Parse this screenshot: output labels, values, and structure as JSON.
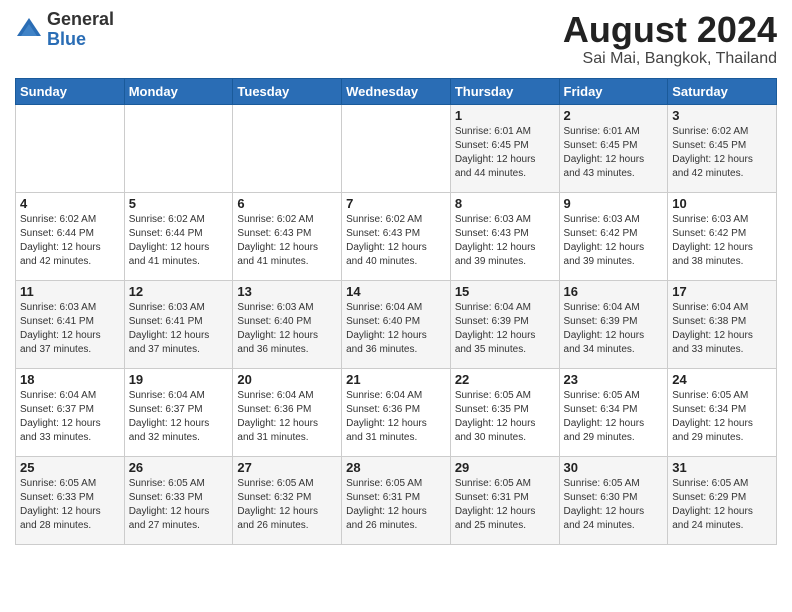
{
  "header": {
    "logo_general": "General",
    "logo_blue": "Blue",
    "month_year": "August 2024",
    "location": "Sai Mai, Bangkok, Thailand"
  },
  "days_of_week": [
    "Sunday",
    "Monday",
    "Tuesday",
    "Wednesday",
    "Thursday",
    "Friday",
    "Saturday"
  ],
  "weeks": [
    [
      {
        "day": "",
        "info": ""
      },
      {
        "day": "",
        "info": ""
      },
      {
        "day": "",
        "info": ""
      },
      {
        "day": "",
        "info": ""
      },
      {
        "day": "1",
        "info": "Sunrise: 6:01 AM\nSunset: 6:45 PM\nDaylight: 12 hours\nand 44 minutes."
      },
      {
        "day": "2",
        "info": "Sunrise: 6:01 AM\nSunset: 6:45 PM\nDaylight: 12 hours\nand 43 minutes."
      },
      {
        "day": "3",
        "info": "Sunrise: 6:02 AM\nSunset: 6:45 PM\nDaylight: 12 hours\nand 42 minutes."
      }
    ],
    [
      {
        "day": "4",
        "info": "Sunrise: 6:02 AM\nSunset: 6:44 PM\nDaylight: 12 hours\nand 42 minutes."
      },
      {
        "day": "5",
        "info": "Sunrise: 6:02 AM\nSunset: 6:44 PM\nDaylight: 12 hours\nand 41 minutes."
      },
      {
        "day": "6",
        "info": "Sunrise: 6:02 AM\nSunset: 6:43 PM\nDaylight: 12 hours\nand 41 minutes."
      },
      {
        "day": "7",
        "info": "Sunrise: 6:02 AM\nSunset: 6:43 PM\nDaylight: 12 hours\nand 40 minutes."
      },
      {
        "day": "8",
        "info": "Sunrise: 6:03 AM\nSunset: 6:43 PM\nDaylight: 12 hours\nand 39 minutes."
      },
      {
        "day": "9",
        "info": "Sunrise: 6:03 AM\nSunset: 6:42 PM\nDaylight: 12 hours\nand 39 minutes."
      },
      {
        "day": "10",
        "info": "Sunrise: 6:03 AM\nSunset: 6:42 PM\nDaylight: 12 hours\nand 38 minutes."
      }
    ],
    [
      {
        "day": "11",
        "info": "Sunrise: 6:03 AM\nSunset: 6:41 PM\nDaylight: 12 hours\nand 37 minutes."
      },
      {
        "day": "12",
        "info": "Sunrise: 6:03 AM\nSunset: 6:41 PM\nDaylight: 12 hours\nand 37 minutes."
      },
      {
        "day": "13",
        "info": "Sunrise: 6:03 AM\nSunset: 6:40 PM\nDaylight: 12 hours\nand 36 minutes."
      },
      {
        "day": "14",
        "info": "Sunrise: 6:04 AM\nSunset: 6:40 PM\nDaylight: 12 hours\nand 36 minutes."
      },
      {
        "day": "15",
        "info": "Sunrise: 6:04 AM\nSunset: 6:39 PM\nDaylight: 12 hours\nand 35 minutes."
      },
      {
        "day": "16",
        "info": "Sunrise: 6:04 AM\nSunset: 6:39 PM\nDaylight: 12 hours\nand 34 minutes."
      },
      {
        "day": "17",
        "info": "Sunrise: 6:04 AM\nSunset: 6:38 PM\nDaylight: 12 hours\nand 33 minutes."
      }
    ],
    [
      {
        "day": "18",
        "info": "Sunrise: 6:04 AM\nSunset: 6:37 PM\nDaylight: 12 hours\nand 33 minutes."
      },
      {
        "day": "19",
        "info": "Sunrise: 6:04 AM\nSunset: 6:37 PM\nDaylight: 12 hours\nand 32 minutes."
      },
      {
        "day": "20",
        "info": "Sunrise: 6:04 AM\nSunset: 6:36 PM\nDaylight: 12 hours\nand 31 minutes."
      },
      {
        "day": "21",
        "info": "Sunrise: 6:04 AM\nSunset: 6:36 PM\nDaylight: 12 hours\nand 31 minutes."
      },
      {
        "day": "22",
        "info": "Sunrise: 6:05 AM\nSunset: 6:35 PM\nDaylight: 12 hours\nand 30 minutes."
      },
      {
        "day": "23",
        "info": "Sunrise: 6:05 AM\nSunset: 6:34 PM\nDaylight: 12 hours\nand 29 minutes."
      },
      {
        "day": "24",
        "info": "Sunrise: 6:05 AM\nSunset: 6:34 PM\nDaylight: 12 hours\nand 29 minutes."
      }
    ],
    [
      {
        "day": "25",
        "info": "Sunrise: 6:05 AM\nSunset: 6:33 PM\nDaylight: 12 hours\nand 28 minutes."
      },
      {
        "day": "26",
        "info": "Sunrise: 6:05 AM\nSunset: 6:33 PM\nDaylight: 12 hours\nand 27 minutes."
      },
      {
        "day": "27",
        "info": "Sunrise: 6:05 AM\nSunset: 6:32 PM\nDaylight: 12 hours\nand 26 minutes."
      },
      {
        "day": "28",
        "info": "Sunrise: 6:05 AM\nSunset: 6:31 PM\nDaylight: 12 hours\nand 26 minutes."
      },
      {
        "day": "29",
        "info": "Sunrise: 6:05 AM\nSunset: 6:31 PM\nDaylight: 12 hours\nand 25 minutes."
      },
      {
        "day": "30",
        "info": "Sunrise: 6:05 AM\nSunset: 6:30 PM\nDaylight: 12 hours\nand 24 minutes."
      },
      {
        "day": "31",
        "info": "Sunrise: 6:05 AM\nSunset: 6:29 PM\nDaylight: 12 hours\nand 24 minutes."
      }
    ]
  ]
}
